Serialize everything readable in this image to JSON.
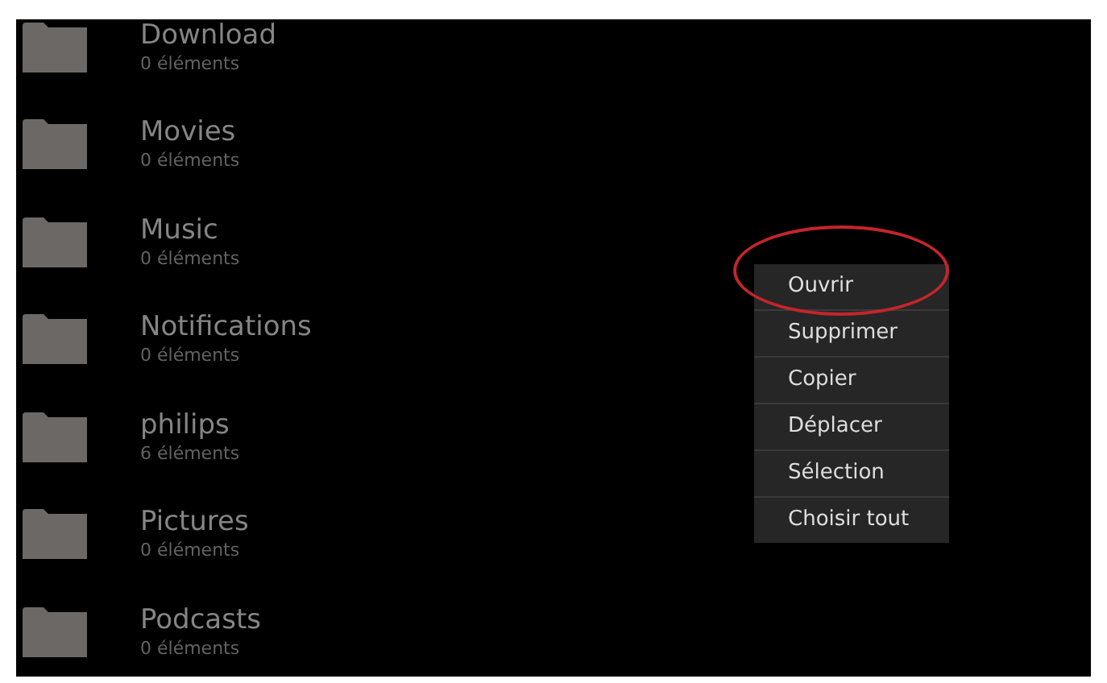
{
  "folders": [
    {
      "name": "Download",
      "count": "0 éléments"
    },
    {
      "name": "Movies",
      "count": "0 éléments"
    },
    {
      "name": "Music",
      "count": "0 éléments"
    },
    {
      "name": "Notifications",
      "count": "0 éléments"
    },
    {
      "name": "philips",
      "count": "6 éléments"
    },
    {
      "name": "Pictures",
      "count": "0 éléments"
    },
    {
      "name": "Podcasts",
      "count": "0 éléments"
    }
  ],
  "context_menu": {
    "items": [
      {
        "label": "Ouvrir",
        "circled": true
      },
      {
        "label": "Supprimer",
        "circled": false
      },
      {
        "label": "Copier",
        "circled": false
      },
      {
        "label": "Déplacer",
        "circled": false
      },
      {
        "label": "Sélection",
        "circled": false
      },
      {
        "label": "Choisir tout",
        "circled": false
      }
    ]
  }
}
